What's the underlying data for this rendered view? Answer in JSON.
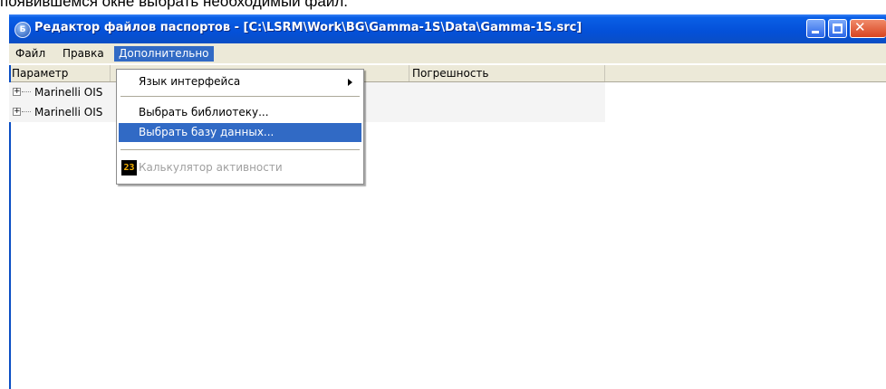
{
  "caption": "появившемся окне выбрать необходимый файл.",
  "window": {
    "title": "Редактор файлов паспортов - [C:\\LSRM\\Work\\BG\\Gamma-1S\\Data\\Gamma-1S.src]",
    "app_icon_glyph": "Б"
  },
  "menubar": {
    "file": "Файл",
    "edit": "Правка",
    "extra": "Дополнительно"
  },
  "table": {
    "columns": [
      "Параметр",
      "",
      "Погрешность"
    ],
    "rows": [
      {
        "label": "Marinelli OIS",
        "expander": "+"
      },
      {
        "label": "Marinelli OIS",
        "expander": "+"
      }
    ]
  },
  "dropdown": {
    "language": "Язык интерфейса",
    "select_library": "Выбрать библиотеку...",
    "select_database": "Выбрать базу данных...",
    "activity_calculator": "Калькулятор активности",
    "calc_icon_glyph": "23"
  },
  "colors": {
    "titlebar": "#0450d8",
    "selection": "#316ac5",
    "menubar_bg": "#ece9d8",
    "disabled_text": "#a0a0a0"
  },
  "icons": {
    "app": "app-icon",
    "minimize": "minimize-icon",
    "maximize": "maximize-icon",
    "close": "close-icon",
    "submenu": "submenu-arrow-icon",
    "calculator": "calculator-icon",
    "expander": "expand-icon"
  }
}
